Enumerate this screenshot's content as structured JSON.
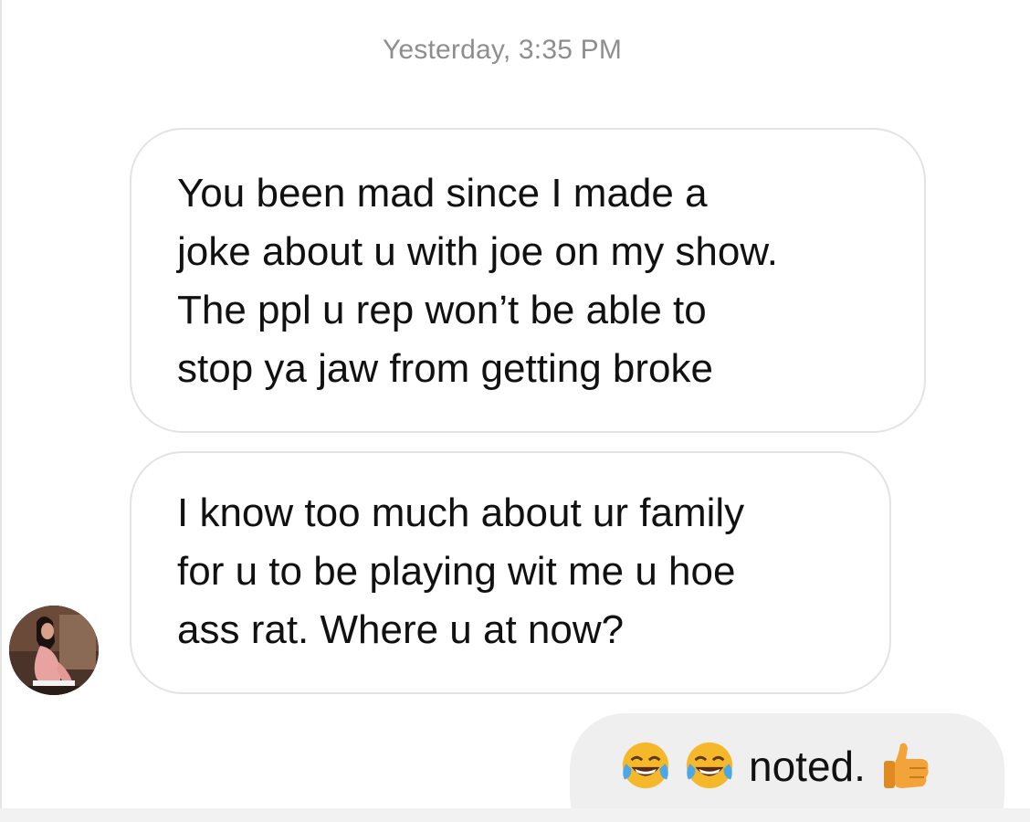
{
  "thread": {
    "timestamp": "Yesterday, 3:35 PM"
  },
  "messages": [
    {
      "lines": [
        "You been mad since I made a",
        "joke about u with joe on my show.",
        "The ppl u rep won’t be able to",
        "stop ya jaw from getting broke"
      ]
    },
    {
      "lines": [
        "I know too much about ur family",
        "for u to be playing wit me u hoe",
        "ass rat. Where u at now?"
      ]
    }
  ],
  "reply": {
    "emoji_1": "face-with-tears-of-joy-icon",
    "emoji_2": "face-with-tears-of-joy-icon",
    "text": "noted.",
    "emoji_3": "thumbs-up-icon"
  },
  "colors": {
    "timestamp": "#8e8e8e",
    "bubble_border": "#e3e3e3",
    "sent_bubble": "#efefef",
    "emoji_yellow": "#f6b82b",
    "thumb_orange": "#f2a33a"
  }
}
